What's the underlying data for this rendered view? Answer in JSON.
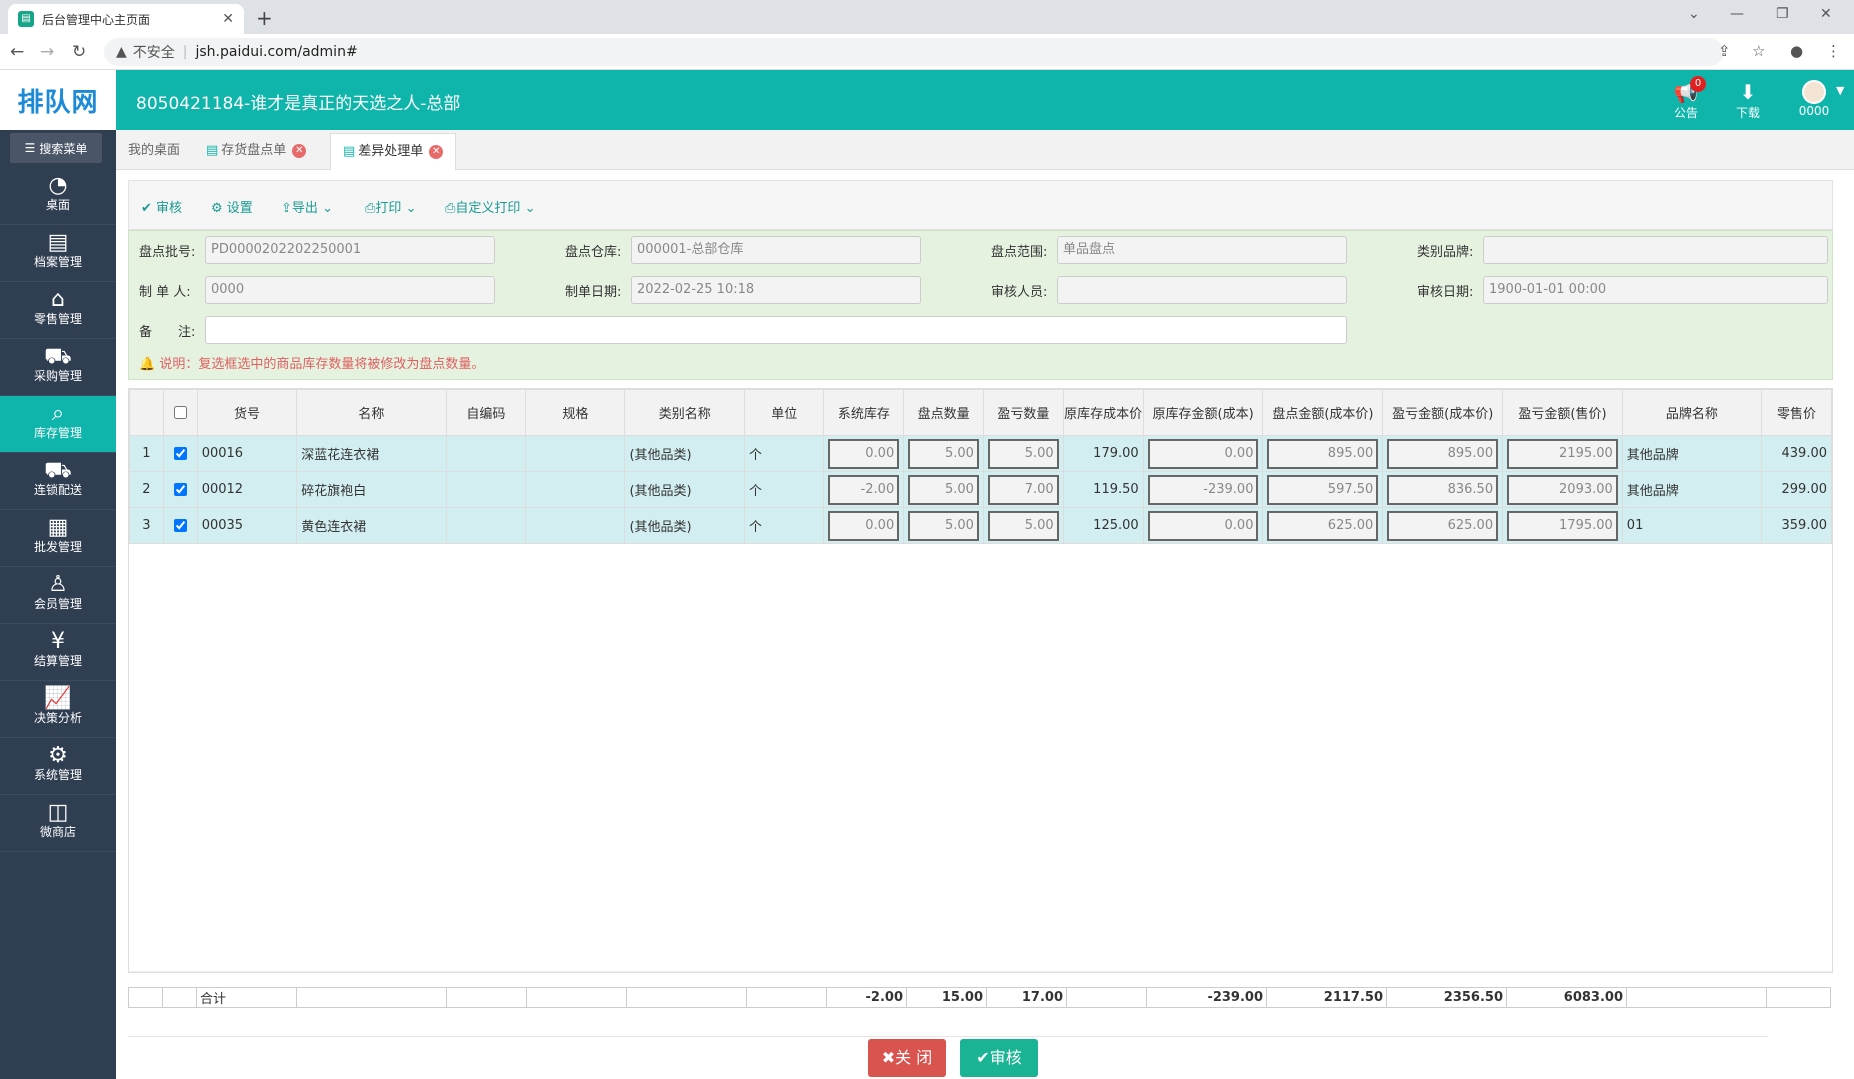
{
  "browser": {
    "tab_title": "后台管理中心主页面",
    "tab_icon": "document-icon",
    "insecure_label": "不安全",
    "url": "jsh.paidui.com/admin#"
  },
  "app": {
    "logo": "排队网",
    "title": "8050421184-谁才是真正的天选之人-总部",
    "notice_label": "公告",
    "notice_count": "0",
    "download_label": "下载",
    "user_label": "0000",
    "theme_color": "#0fb5ab",
    "sidebar_color": "#2f3e51"
  },
  "sidebar": {
    "search_label": "搜索菜单",
    "items": [
      {
        "label": "桌面",
        "icon": "dashboard-icon"
      },
      {
        "label": "档案管理",
        "icon": "archive-icon"
      },
      {
        "label": "零售管理",
        "icon": "store-icon"
      },
      {
        "label": "采购管理",
        "icon": "cart-icon"
      },
      {
        "label": "库存管理",
        "icon": "inventory-search-icon",
        "active": true
      },
      {
        "label": "连锁配送",
        "icon": "truck-icon"
      },
      {
        "label": "批发管理",
        "icon": "wholesale-icon"
      },
      {
        "label": "会员管理",
        "icon": "member-icon"
      },
      {
        "label": "结算管理",
        "icon": "yen-icon"
      },
      {
        "label": "决策分析",
        "icon": "chart-icon"
      },
      {
        "label": "系统管理",
        "icon": "gear-icon"
      },
      {
        "label": "微商店",
        "icon": "shop-bag-icon"
      }
    ]
  },
  "page_tabs": [
    {
      "label": "我的桌面"
    },
    {
      "label": "存货盘点单"
    },
    {
      "label": "差异处理单",
      "active": true
    }
  ],
  "toolbar": {
    "audit": "审核",
    "settings": "设置",
    "export": "导出",
    "print": "打印",
    "custom_print": "自定义打印"
  },
  "form": {
    "batch_label": "盘点批号:",
    "batch_value": "PD0000202202250001",
    "warehouse_label": "盘点仓库:",
    "warehouse_value": "000001-总部仓库",
    "scope_label": "盘点范围:",
    "scope_value": "单品盘点",
    "brand_label": "类别品牌:",
    "brand_value": "",
    "maker_label": "制 单 人:",
    "maker_value": "0000",
    "date_label": "制单日期:",
    "date_value": "2022-02-25 10:18",
    "auditor_label": "审核人员:",
    "auditor_value": "",
    "audit_date_label": "审核日期:",
    "audit_date_value": "1900-01-01 00:00",
    "remark_label": "备　　注:",
    "remark_value": "",
    "note": "说明：复选框选中的商品库存数量将被修改为盘点数量。"
  },
  "table": {
    "columns": [
      "",
      "",
      "货号",
      "名称",
      "自编码",
      "规格",
      "类别名称",
      "单位",
      "系统库存",
      "盘点数量",
      "盈亏数量",
      "原库存成本价",
      "原库存金额(成本)",
      "盘点金额(成本价)",
      "盈亏金额(成本价)",
      "盈亏金额(售价)",
      "品牌名称",
      "零售价"
    ],
    "rows": [
      {
        "idx": "1",
        "checked": true,
        "code": "00016",
        "name": "深蓝花连衣裙",
        "selfcode": "",
        "spec": "",
        "category": "(其他品类)",
        "unit": "个",
        "sys_stock": "0.00",
        "count_qty": "5.00",
        "diff_qty": "5.00",
        "cost_price": "179.00",
        "orig_amount": "0.00",
        "count_amount": "895.00",
        "diff_amount_cost": "895.00",
        "diff_amount_sale": "2195.00",
        "brand": "其他品牌",
        "retail": "439.00"
      },
      {
        "idx": "2",
        "checked": true,
        "code": "00012",
        "name": "碎花旗袍白",
        "selfcode": "",
        "spec": "",
        "category": "(其他品类)",
        "unit": "个",
        "sys_stock": "-2.00",
        "count_qty": "5.00",
        "diff_qty": "7.00",
        "cost_price": "119.50",
        "orig_amount": "-239.00",
        "count_amount": "597.50",
        "diff_amount_cost": "836.50",
        "diff_amount_sale": "2093.00",
        "brand": "其他品牌",
        "retail": "299.00"
      },
      {
        "idx": "3",
        "checked": true,
        "code": "00035",
        "name": "黄色连衣裙",
        "selfcode": "",
        "spec": "",
        "category": "(其他品类)",
        "unit": "个",
        "sys_stock": "0.00",
        "count_qty": "5.00",
        "diff_qty": "5.00",
        "cost_price": "125.00",
        "orig_amount": "0.00",
        "count_amount": "625.00",
        "diff_amount_cost": "625.00",
        "diff_amount_sale": "1795.00",
        "brand": "01",
        "retail": "359.00"
      }
    ],
    "totals": {
      "label": "合计",
      "sys_stock": "-2.00",
      "count_qty": "15.00",
      "diff_qty": "17.00",
      "orig_amount": "-239.00",
      "count_amount": "2117.50",
      "diff_amount_cost": "2356.50",
      "diff_amount_sale": "6083.00"
    }
  },
  "buttons": {
    "close": "关 闭",
    "audit": "审核"
  }
}
